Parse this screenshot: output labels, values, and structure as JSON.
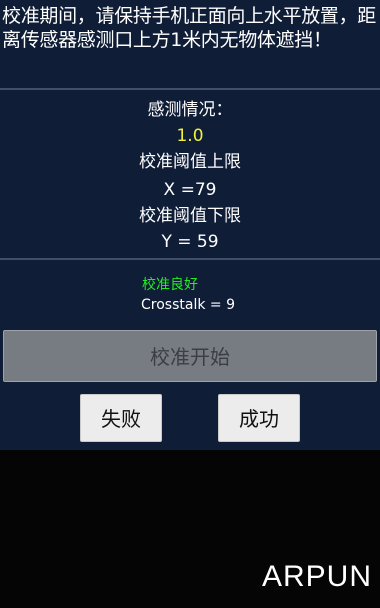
{
  "instruction": "校准期间，请保持手机正面向上水平放置，距离传感器感测口上方1米内无物体遮挡！",
  "sensing": {
    "label": "感测情况：",
    "value": "1.0"
  },
  "threshold_upper": {
    "label": "校准阈值上限",
    "value": "X =79"
  },
  "threshold_lower": {
    "label": "校准阈值下限",
    "value": "Y = 59"
  },
  "status": "校准良好",
  "crosstalk": "Crosstalk = 9",
  "buttons": {
    "start": "校准开始",
    "fail": "失败",
    "success": "成功"
  },
  "watermark": "ARPUN",
  "colors": {
    "panel_bg": "#0f1d37",
    "value_yellow": "#f1f13b",
    "status_green": "#22ee22"
  }
}
